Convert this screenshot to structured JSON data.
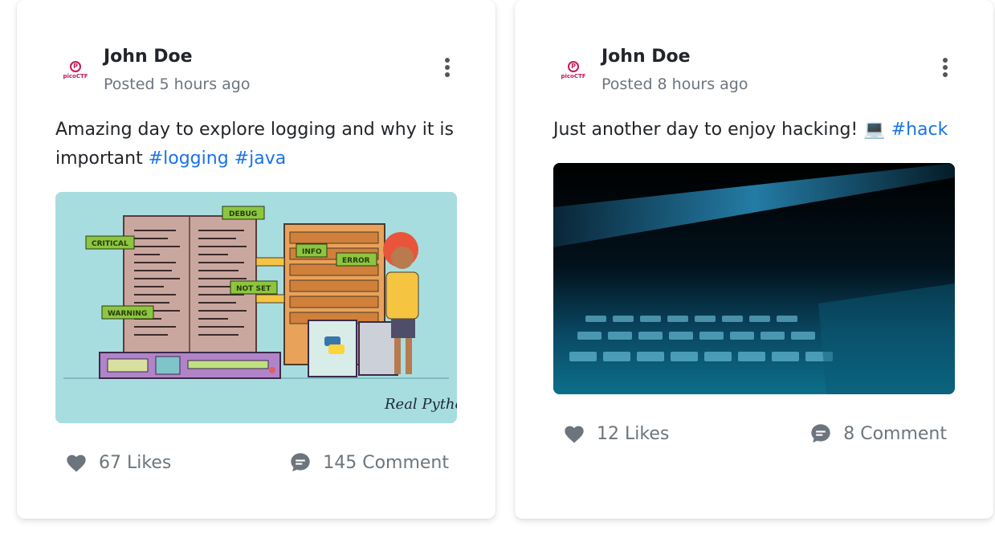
{
  "posts": [
    {
      "author": "John Doe",
      "posted": "Posted 5 hours ago",
      "avatar_brand": "picoCTF",
      "text": "Amazing day to explore logging and why it is important",
      "hashtags": [
        "#logging",
        "#java"
      ],
      "image": {
        "labels": [
          "DEBUG",
          "CRITICAL",
          "INFO",
          "ERROR",
          "NOT SET",
          "WARNING"
        ],
        "watermark": "Real Python"
      },
      "likes": "67 Likes",
      "comments": "145 Comment"
    },
    {
      "author": "John Doe",
      "posted": "Posted 8 hours ago",
      "avatar_brand": "picoCTF",
      "text": "Just another day to enjoy hacking! 💻",
      "hashtags": [
        "#hack"
      ],
      "likes": "12 Likes",
      "comments": "8 Comment"
    }
  ],
  "colors": {
    "link": "#1a73e8",
    "muted": "#6c757d",
    "heading": "#212529",
    "illustration_bg": "#a8dde0",
    "avatar_brand": "#c2185b"
  },
  "icons": [
    "kebab-menu-icon",
    "heart-icon",
    "comment-bubble-icon",
    "laptop-emoji"
  ]
}
